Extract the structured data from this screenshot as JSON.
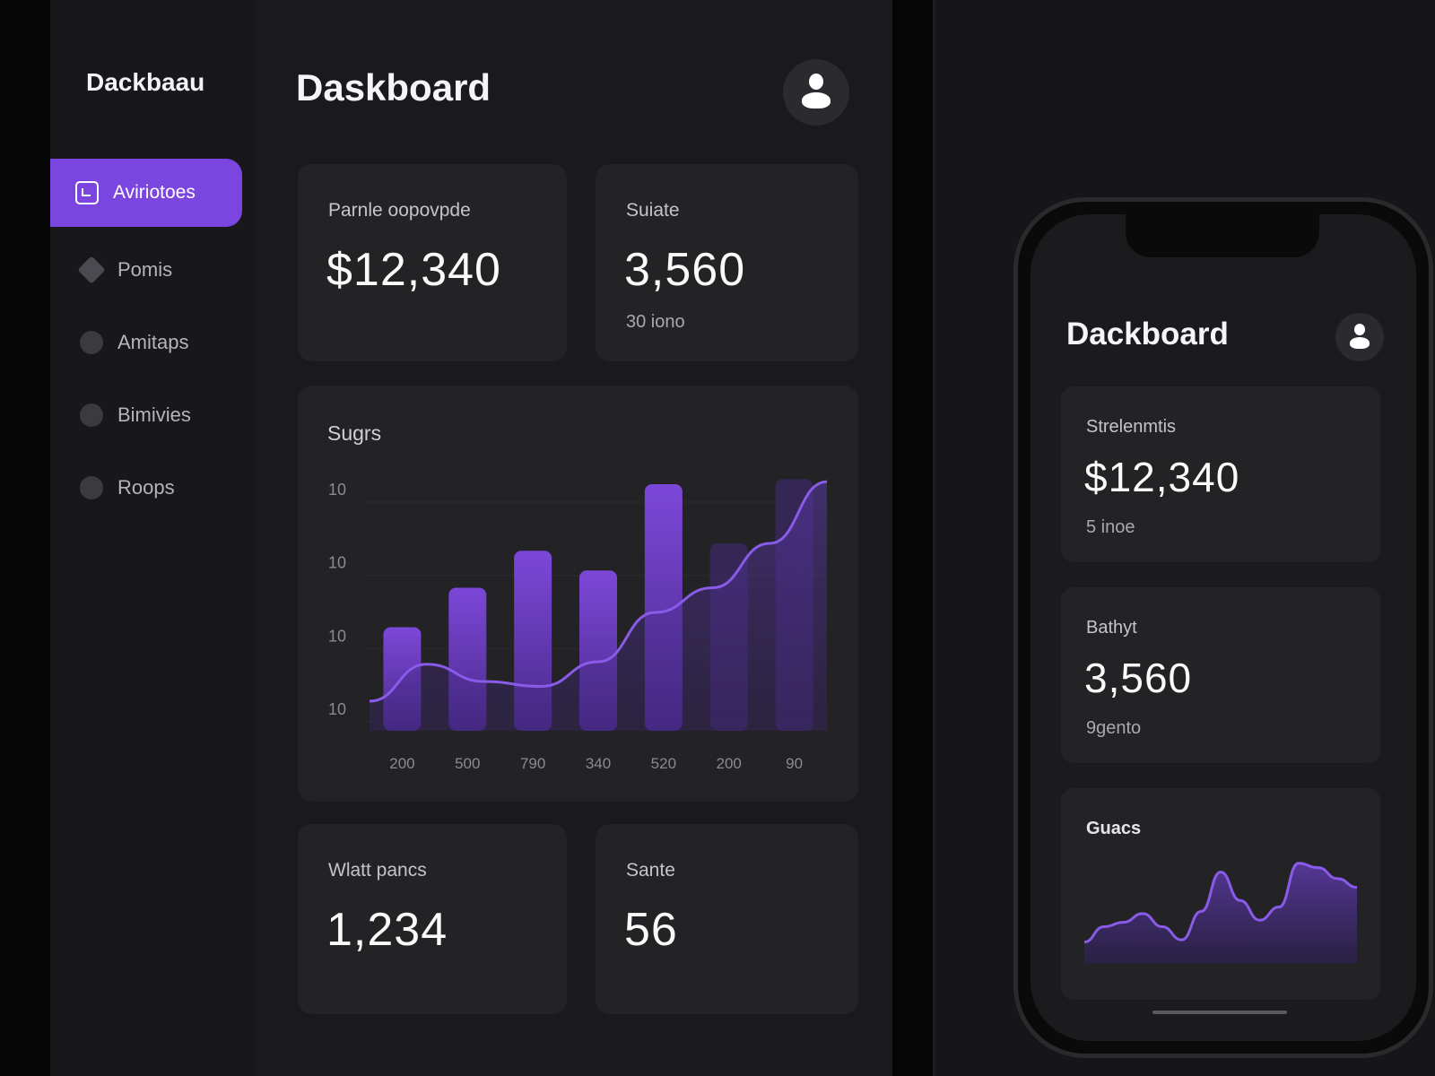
{
  "sidebar": {
    "brand": "Dackbaau",
    "items": [
      {
        "label": "Aviriotoes",
        "icon": "layout-icon",
        "active": true
      },
      {
        "label": "Pomis",
        "icon": "tag-icon"
      },
      {
        "label": "Amitaps",
        "icon": "circle-icon"
      },
      {
        "label": "Bimivies",
        "icon": "circle-icon"
      },
      {
        "label": "Roops",
        "icon": "circle-icon"
      }
    ]
  },
  "desktop": {
    "title": "Daskboard",
    "cards": {
      "revenue": {
        "label": "Parnle oopovpde",
        "value": "$12,340"
      },
      "users": {
        "label": "Suiate",
        "value": "3,560",
        "sub": "30 iono"
      },
      "orders": {
        "label": "Wlatt pancs",
        "value": "1,234"
      },
      "tickets": {
        "label": "Sante",
        "value": "56"
      }
    },
    "chart_title": "Sugrs"
  },
  "mobile": {
    "title": "Dackboard",
    "cards": {
      "revenue": {
        "label": "Strelenmtis",
        "value": "$12,340",
        "sub": "5 inoe"
      },
      "users": {
        "label": "Bathyt",
        "value": "3,560",
        "sub": "9gento"
      }
    },
    "chart_title": "Guacs"
  },
  "colors": {
    "accent": "#7b46e0",
    "bar": "#7c47d8",
    "line": "#8a5be8",
    "background": "#1a1a1d",
    "card": "#232326"
  },
  "chart_data": [
    {
      "type": "bar",
      "title": "Sugrs",
      "xlabel": "",
      "ylabel": "",
      "x_tick_labels": [
        "200",
        "500",
        "790",
        "340",
        "520",
        "200",
        "90"
      ],
      "y_tick_labels": [
        "10",
        "10",
        "10",
        "10"
      ],
      "ylim": [
        0,
        100
      ],
      "series": [
        {
          "values": [
            42,
            58,
            73,
            65,
            100,
            76,
            102
          ]
        },
        {
          "values": [
            12,
            27,
            20,
            18,
            28,
            48,
            58,
            76,
            101
          ]
        }
      ],
      "grid": true
    },
    {
      "type": "area",
      "title": "Guacs",
      "values": [
        20,
        34,
        38,
        46,
        34,
        22,
        48,
        84,
        58,
        40,
        52,
        92,
        88,
        78,
        70
      ],
      "ylim": [
        0,
        100
      ]
    }
  ]
}
